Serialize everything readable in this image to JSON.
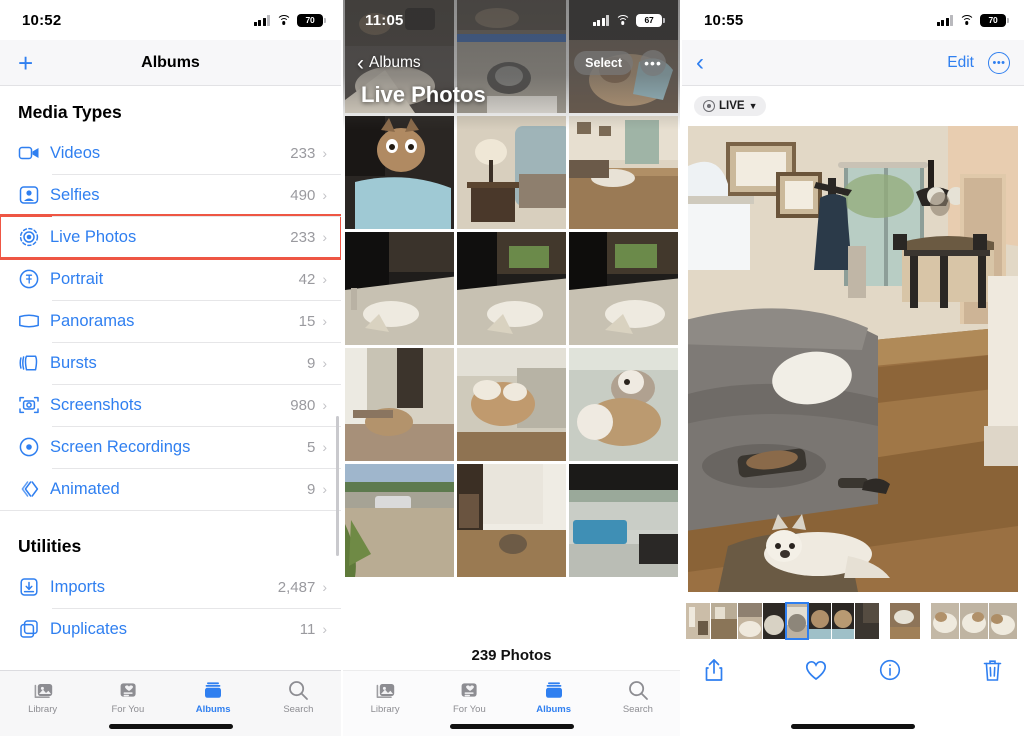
{
  "left": {
    "status": {
      "time": "10:52",
      "battery": "70"
    },
    "nav": {
      "add_label": "+",
      "title": "Albums"
    },
    "sections": [
      {
        "header": "Media Types",
        "rows": [
          {
            "icon": "video-icon",
            "label": "Videos",
            "count": "233"
          },
          {
            "icon": "selfie-icon",
            "label": "Selfies",
            "count": "490"
          },
          {
            "icon": "live-photo-icon",
            "label": "Live Photos",
            "count": "233",
            "highlighted": true
          },
          {
            "icon": "portrait-icon",
            "label": "Portrait",
            "count": "42"
          },
          {
            "icon": "panorama-icon",
            "label": "Panoramas",
            "count": "15"
          },
          {
            "icon": "burst-icon",
            "label": "Bursts",
            "count": "9"
          },
          {
            "icon": "screenshot-icon",
            "label": "Screenshots",
            "count": "980"
          },
          {
            "icon": "screen-recording-icon",
            "label": "Screen Recordings",
            "count": "5"
          },
          {
            "icon": "animated-icon",
            "label": "Animated",
            "count": "9"
          }
        ]
      },
      {
        "header": "Utilities",
        "rows": [
          {
            "icon": "import-icon",
            "label": "Imports",
            "count": "2,487"
          },
          {
            "icon": "duplicate-icon",
            "label": "Duplicates",
            "count": "11"
          }
        ]
      }
    ],
    "tabs": [
      {
        "icon": "library-icon",
        "label": "Library",
        "active": false
      },
      {
        "icon": "for-you-icon",
        "label": "For You",
        "active": false
      },
      {
        "icon": "albums-icon",
        "label": "Albums",
        "active": true
      },
      {
        "icon": "search-icon",
        "label": "Search",
        "active": false
      }
    ]
  },
  "middle": {
    "status": {
      "time": "11:05",
      "battery": "67"
    },
    "nav": {
      "back_label": "Albums",
      "select_label": "Select",
      "more_label": "•••"
    },
    "big_title": "Live Photos",
    "photo_count": "239 Photos",
    "tabs": [
      {
        "icon": "library-icon",
        "label": "Library",
        "active": false
      },
      {
        "icon": "for-you-icon",
        "label": "For You",
        "active": false
      },
      {
        "icon": "albums-icon",
        "label": "Albums",
        "active": true
      },
      {
        "icon": "search-icon",
        "label": "Search",
        "active": false
      }
    ]
  },
  "right": {
    "status": {
      "time": "10:55",
      "battery": "70"
    },
    "nav": {
      "edit_label": "Edit",
      "more_label": "•••"
    },
    "live_badge": {
      "label": "LIVE"
    },
    "toolbar": [
      {
        "icon": "share-icon",
        "name": "share-button"
      },
      {
        "icon": "heart-icon",
        "name": "favorite-button"
      },
      {
        "icon": "info-icon",
        "name": "info-button"
      },
      {
        "icon": "trash-icon",
        "name": "delete-button"
      }
    ]
  },
  "colors": {
    "accent": "#2f7ff0",
    "highlight": "#ee5644",
    "secondary_text": "#9a9a9f",
    "chrome_bg": "#f6f6f8"
  }
}
